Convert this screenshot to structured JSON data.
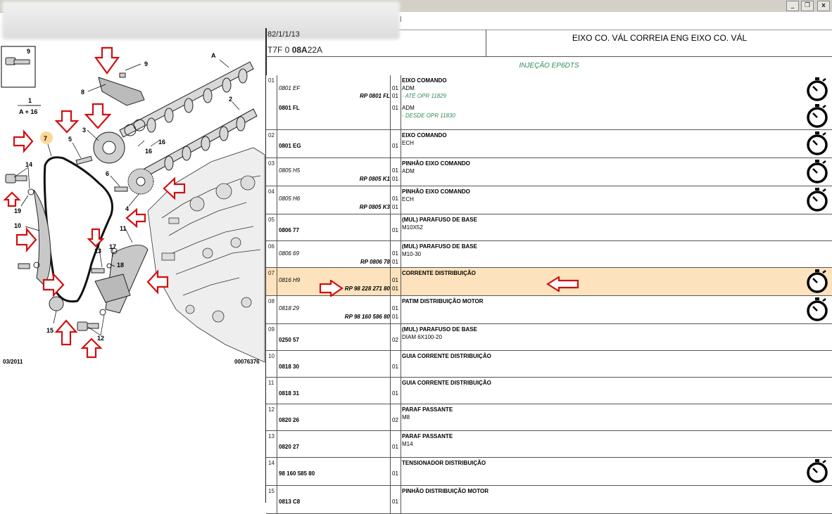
{
  "window": {
    "minimize": "_",
    "restore": "❐",
    "close": "x"
  },
  "menu": {
    "item": "l"
  },
  "header": {
    "code_line1": "82/1/1/13",
    "code_prefix": "T7F 0",
    "code_bold": "08A",
    "code_suffix": "22A",
    "title": "EIXO CO. VÁL CORREIA ENG EIXO CO. VÁL",
    "subtitle": "INJEÇÃO EP6DTS"
  },
  "diagram": {
    "date": "03/2011",
    "ref": "00076376",
    "labels": {
      "n9_box": "9",
      "n9": "9",
      "n8": "8",
      "A": "A",
      "n1": "1",
      "A16": "A + 16",
      "n3": "3",
      "n2": "2",
      "n5": "5",
      "n7": "7",
      "n16a": "16",
      "n16b": "16",
      "n14": "14",
      "n6": "6",
      "n19": "19",
      "n4": "4",
      "n10": "10",
      "n11": "11",
      "n13": "13",
      "n17": "17",
      "n18": "18",
      "n15": "15",
      "n12": "12"
    }
  },
  "rows": [
    {
      "idx": "01",
      "timer": true,
      "lines": [
        {
          "ref": "0801 EF",
          "ref_style": "it",
          "rp": "RP 0801 FL",
          "qty": "01",
          "qty2": "01",
          "desc": "EIXO COMANDO",
          "spec": "ADM",
          "spec2": "- ATÉ OPR 11829"
        },
        {
          "ref": "0801 FL",
          "ref_style": "b",
          "qty": "01",
          "spec": "ADM",
          "spec2": "- DESDE OPR 11830"
        }
      ]
    },
    {
      "idx": "02",
      "ref": "0801 EG",
      "ref_style": "b",
      "qty": "01",
      "desc": "EIXO COMANDO",
      "spec": "ECH",
      "timer": true
    },
    {
      "idx": "03",
      "ref": "0805 H5",
      "ref_style": "it",
      "qty": "01",
      "rp": "RP 0805 K1",
      "qty2": "01",
      "desc": "PINHÃO EIXO COMANDO",
      "spec": "ADM",
      "timer": true
    },
    {
      "idx": "04",
      "ref": "0805 H6",
      "ref_style": "it",
      "qty": "01",
      "rp": "RP 0805 K3",
      "qty2": "01",
      "desc": "PINHÃO EIXO COMANDO",
      "spec": "ECH",
      "timer": true
    },
    {
      "idx": "05",
      "ref": "0806 77",
      "ref_style": "b",
      "qty": "01",
      "desc": "(MUL) PARAFUSO DE BASE",
      "spec": "M10X52",
      "timer": false
    },
    {
      "idx": "06",
      "ref": "0806 69",
      "ref_style": "it",
      "qty": "01",
      "rp": "RP 0806 78",
      "qty2": "01",
      "desc": "(MUL) PARAFUSO DE BASE",
      "spec": "M10-30",
      "timer": false
    },
    {
      "idx": "07",
      "ref": "0816 H9",
      "ref_style": "it",
      "qty": "01",
      "rp": "RP 98 228 271 80",
      "qty2": "01",
      "desc": "CORRENTE DISTRIBUIÇÃO",
      "spec": "",
      "timer": true,
      "highlight": true
    },
    {
      "idx": "08",
      "ref": "0818 29",
      "ref_style": "it",
      "qty": "01",
      "rp": "RP 98 160 586 80",
      "qty2": "01",
      "desc": "PATIM DISTRIBUIÇÃO MOTOR",
      "spec": "",
      "timer": true
    },
    {
      "idx": "09",
      "ref": "0250 57",
      "ref_style": "b",
      "qty": "02",
      "desc": "(MUL) PARAFUSO DE BASE",
      "spec": "DIAM 6X100-20",
      "timer": false
    },
    {
      "idx": "10",
      "ref": "0818 30",
      "ref_style": "b",
      "qty": "01",
      "desc": "GUIA CORRENTE DISTRIBUIÇÃO",
      "spec": "",
      "timer": false
    },
    {
      "idx": "11",
      "ref": "0818 31",
      "ref_style": "b",
      "qty": "01",
      "desc": "GUIA CORRENTE DISTRIBUIÇÃO",
      "spec": "",
      "timer": false
    },
    {
      "idx": "12",
      "ref": "0820 26",
      "ref_style": "b",
      "qty": "02",
      "desc": "PARAF PASSANTE",
      "spec": "M8",
      "timer": false
    },
    {
      "idx": "13",
      "ref": "0820 27",
      "ref_style": "b",
      "qty": "01",
      "desc": "PARAF PASSANTE",
      "spec": "M14",
      "timer": false
    },
    {
      "idx": "14",
      "ref": "98 160 585 80",
      "ref_style": "b",
      "qty": "01",
      "desc": "TENSIONADOR DISTRIBUIÇÃO",
      "spec": "",
      "timer": true
    },
    {
      "idx": "15",
      "ref": "0813 C8",
      "ref_style": "b",
      "qty": "01",
      "desc": "PINHÃO DISTRIBUIÇÃO MOTOR",
      "spec": "",
      "timer": false
    }
  ]
}
